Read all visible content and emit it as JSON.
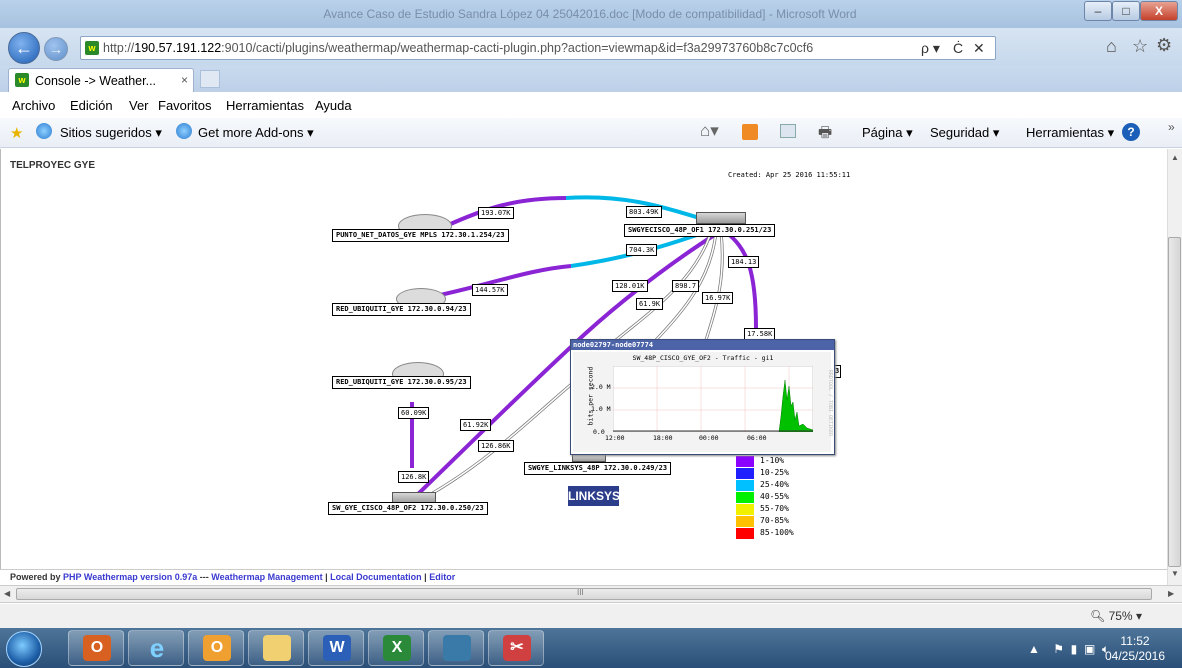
{
  "window": {
    "title": "Avance Caso de Estudio Sandra López 04 25042016.doc [Modo de compatibilidad] - Microsoft Word",
    "minimize": "–",
    "maximize": "□",
    "close": "X"
  },
  "address": {
    "url_prefix": "http://",
    "url_host": "190.57.191.122",
    "url_rest": ":9010/cacti/plugins/weathermap/weathermap-cacti-plugin.php?action=viewmap&id=f3a29973760b8c7c0cf6",
    "search_glyph": "ρ ▾",
    "refresh_glyph": "Ċ",
    "stop_glyph": "✕"
  },
  "tab": {
    "label": "Console -> Weather...",
    "close": "×"
  },
  "menu": [
    "Archivo",
    "Edición",
    "Ver",
    "Favoritos",
    "Herramientas",
    "Ayuda"
  ],
  "favorites": {
    "suggested": "Sitios sugeridos ▾",
    "addons": "Get more Add-ons ▾"
  },
  "commandbar": {
    "page": "Página ▾",
    "security": "Seguridad ▾",
    "tools": "Herramientas ▾",
    "help": "?",
    "chevron": "»"
  },
  "page": {
    "title": "TELPROYEC GYE",
    "created": "Created: Apr 25 2016 11:55:11"
  },
  "map": {
    "nodes": {
      "punto_net": "PUNTO_NET_DATOS_GYE MPLS 172.30.1.254/23",
      "core_switch": "SWGYECISCO_48P_OF1 172.30.0.251/23",
      "ubiquiti_94": "RED_UBIQUITI_GYE 172.30.0.94/23",
      "ubiquiti_95": "RED_UBIQUITI_GYE 172.30.0.95/23",
      "sw_of2": "SW_GYE_CISCO_48P_OF2  172.30.0.250/23",
      "linksys": "SWGYE_LINKSYS_48P 172.30.0.249/23",
      "linksys_logo": "LINKSYS",
      "hidden_suffix": "3"
    },
    "bandwidth": {
      "b1": "193.07K",
      "b2": "803.49K",
      "b3": "704.3K",
      "b4": "144.57K",
      "b5": "128.01K",
      "b6": "898.7",
      "b7": "184.13",
      "b8": "61.9K",
      "b9": "16.97K",
      "b10": "17.58K",
      "b11": "60.09K",
      "b12": "61.92K",
      "b13": "126.86K",
      "b14": "126.8K"
    },
    "legend": [
      {
        "label": "1-10%",
        "color": "#8c00ff"
      },
      {
        "label": "10-25%",
        "color": "#2020ff"
      },
      {
        "label": "25-40%",
        "color": "#00c0ff"
      },
      {
        "label": "40-55%",
        "color": "#00f000"
      },
      {
        "label": "55-70%",
        "color": "#f0f000"
      },
      {
        "label": "70-85%",
        "color": "#ffc000"
      },
      {
        "label": "85-100%",
        "color": "#ff0000"
      }
    ]
  },
  "popup": {
    "header": "node02797-node07774",
    "graph_title": "SW_48P_CISCO_GYE_OF2 - Traffic - gi1",
    "ylabel": "bits per second",
    "yticks": [
      "2.0 M",
      "1.0 M",
      "0.0"
    ],
    "xticks": [
      "12:00",
      "18:00",
      "00:00",
      "06:00"
    ],
    "side_text": "RRDTOOL / TOBI OETIKER"
  },
  "footer": {
    "prefix": "Powered by ",
    "link1": "PHP Weathermap version 0.97a",
    "sep1": " --- ",
    "link2": "Weathermap Management",
    "sep2": " | ",
    "link3": "Local Documentation",
    "sep3": " | ",
    "link4": "Editor"
  },
  "status": {
    "zoom": "75%",
    "scroll_mid": "III"
  },
  "taskbar": {
    "time": "11:52",
    "date": "04/25/2016"
  }
}
